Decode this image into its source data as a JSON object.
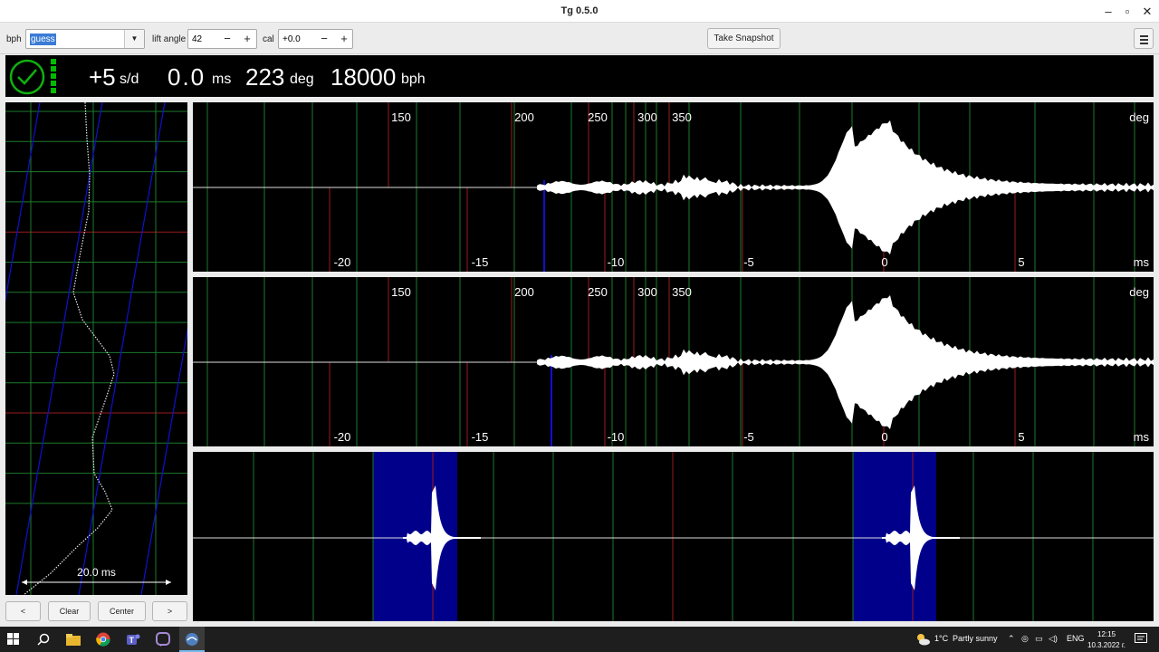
{
  "window": {
    "title": "Tg 0.5.0",
    "minimize": "–",
    "maximize": "▫",
    "close": "✕"
  },
  "toolbar": {
    "bph_label": "bph",
    "bph_value": "guess",
    "lift_angle_label": "lift angle",
    "lift_angle_value": "42",
    "cal_label": "cal",
    "cal_value": "+0.0",
    "minus": "−",
    "plus": "+",
    "snapshot_label": "Take Snapshot"
  },
  "status": {
    "rate_value": "+5",
    "rate_unit": "s/d",
    "beat_error_value": "0.0",
    "beat_error_unit": "ms",
    "amplitude_value": "223",
    "amplitude_unit": "deg",
    "bph_value": "18000",
    "bph_unit": "bph",
    "colors": {
      "ok": "#0fb00f"
    }
  },
  "paperstrip": {
    "scale_label": "20.0 ms"
  },
  "waveform_top": {
    "deg_ticks": [
      "150",
      "200",
      "250",
      "300",
      "350"
    ],
    "deg_unit": "deg",
    "ms_ticks": [
      "-20",
      "-15",
      "-10",
      "-5",
      "0",
      "5"
    ],
    "ms_unit": "ms"
  },
  "waveform_mid": {
    "deg_ticks": [
      "150",
      "200",
      "250",
      "300",
      "350"
    ],
    "deg_unit": "deg",
    "ms_ticks": [
      "-20",
      "-15",
      "-10",
      "-5",
      "0",
      "5"
    ],
    "ms_unit": "ms"
  },
  "controls": {
    "prev": "<",
    "clear": "Clear",
    "center": "Center",
    "next": ">"
  },
  "taskbar": {
    "weather_temp": "1°C",
    "weather_text": "Partly sunny",
    "language": "ENG",
    "time": "12:15",
    "date": "10.3.2022 г."
  },
  "colors": {
    "grid_green": "#1d7a2b",
    "grid_red": "#9a1b1b",
    "trace_blue": "#1010d0",
    "highlight": "#00008b"
  }
}
